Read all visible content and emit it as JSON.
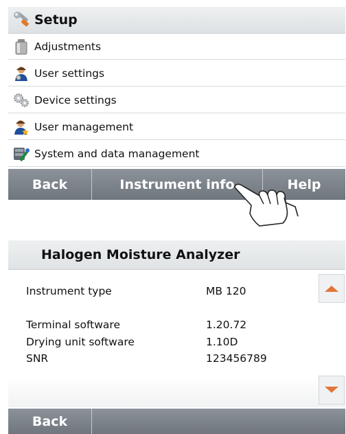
{
  "setup": {
    "title": "Setup",
    "icon": "wrench-icon",
    "items": [
      {
        "label": "Adjustments",
        "icon": "weight-icon"
      },
      {
        "label": "User settings",
        "icon": "user-settings-icon"
      },
      {
        "label": "Device settings",
        "icon": "gears-icon"
      },
      {
        "label": "User management",
        "icon": "user-star-icon"
      },
      {
        "label": "System and data management",
        "icon": "system-tools-icon"
      }
    ],
    "buttons": {
      "back": "Back",
      "instrument_info": "Instrument info",
      "help": "Help"
    }
  },
  "instrument_info": {
    "title": "Halogen Moisture Analyzer",
    "rows": [
      {
        "label": "Instrument type",
        "value": "MB 120"
      },
      {
        "label": "Terminal software",
        "value": "1.20.72"
      },
      {
        "label": "Drying unit software",
        "value": "1.10D"
      },
      {
        "label": "SNR",
        "value": "123456789"
      }
    ],
    "back_label": "Back"
  },
  "colors": {
    "scroll_arrow": "#e0763a",
    "button_bar": "#7c838a"
  }
}
